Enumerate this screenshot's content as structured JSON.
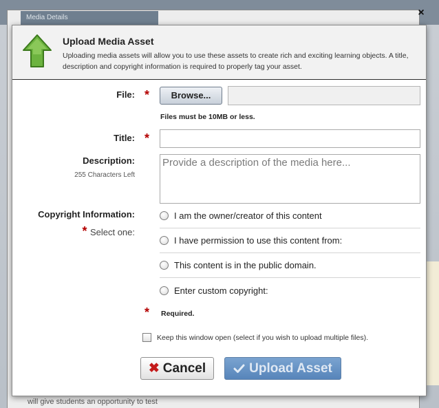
{
  "background": {
    "tab_title": "Media Details",
    "bottom_text": "will give students an opportunity to test"
  },
  "dialog": {
    "close_glyph": "×",
    "header": {
      "icon": "green-up-arrow-icon",
      "title": "Upload Media Asset",
      "description": "Uploading media assets will allow you to use these assets to create rich and exciting learning objects.  A title, description and copyright information is required to properly tag your asset."
    },
    "file": {
      "label": "File:",
      "browse_label": "Browse...",
      "note": "Files must be 10MB or less."
    },
    "title_field": {
      "label": "Title:",
      "value": ""
    },
    "description": {
      "label": "Description:",
      "chars_left": "255 Characters Left",
      "placeholder": "Provide a description of the media here..."
    },
    "copyright": {
      "label": "Copyright Information:",
      "select_one": "Select one:",
      "options": [
        "I am the owner/creator of this content",
        "I have permission to use this content from:",
        "This content is in the public domain.",
        "Enter custom copyright:"
      ]
    },
    "required_star": "*",
    "required_note": "Required.",
    "keep_open_label": "Keep this window open (select if you wish to upload multiple files).",
    "buttons": {
      "cancel": "Cancel",
      "upload": "Upload Asset"
    }
  },
  "colors": {
    "required": "#b40000",
    "upload_button": "#5785ba",
    "cancel_icon": "#c41a1a",
    "header_icon": "#5a9e2a"
  }
}
